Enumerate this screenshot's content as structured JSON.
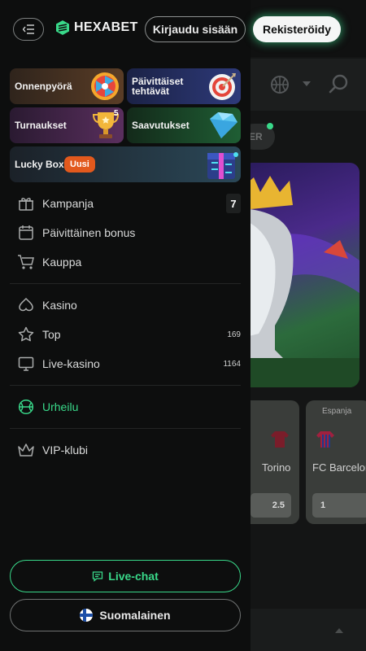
{
  "header": {
    "logo_text": "HEXABET",
    "login_label": "Kirjaudu sisään",
    "register_label": "Rekisteröidy"
  },
  "promos": [
    {
      "label": "Onnenpyörä",
      "icon": "wheel-icon",
      "color": "#3b2b21"
    },
    {
      "label_line1": "Päivittäiset",
      "label_line2": "tehtävät",
      "icon": "target-icon",
      "color": "#1e2348"
    },
    {
      "label": "Turnaukset",
      "icon": "trophy-icon",
      "badge": "5",
      "color": "#3a1f3d"
    },
    {
      "label": "Saavutukset",
      "icon": "diamond-icon",
      "color": "#17301f"
    },
    {
      "label": "Lucky Box",
      "badge": "Uusi",
      "icon": "lucky-box-icon",
      "color": "#1f2c36"
    }
  ],
  "menu": {
    "group1": [
      {
        "label": "Kampanja",
        "icon": "gift-icon",
        "count": "7"
      },
      {
        "label": "Päivittäinen bonus",
        "icon": "calendar-icon"
      },
      {
        "label": "Kauppa",
        "icon": "cart-icon"
      }
    ],
    "group2": [
      {
        "label": "Kasino",
        "icon": "spade-icon"
      },
      {
        "label": "Top",
        "icon": "star-icon",
        "count": "169"
      },
      {
        "label": "Live-kasino",
        "icon": "monitor-icon",
        "count": "1164"
      }
    ],
    "group3": [
      {
        "label": "Urheilu",
        "icon": "basketball-icon",
        "active": true
      }
    ],
    "group4": [
      {
        "label": "VIP-klubi",
        "icon": "crown-icon"
      }
    ]
  },
  "footer": {
    "livechat_label": "Live-chat",
    "language_label": "Suomalainen"
  },
  "background": {
    "chip_text": "ER",
    "card1_team": "Torino",
    "card1_odd": "2.5",
    "card2_team": "FC Barcelor",
    "card2_league": "Espanja",
    "card2_odd": "1"
  },
  "colors": {
    "accent": "#39d98a",
    "new_badge": "#e2591d",
    "drawer_bg": "#0d0e0e"
  }
}
